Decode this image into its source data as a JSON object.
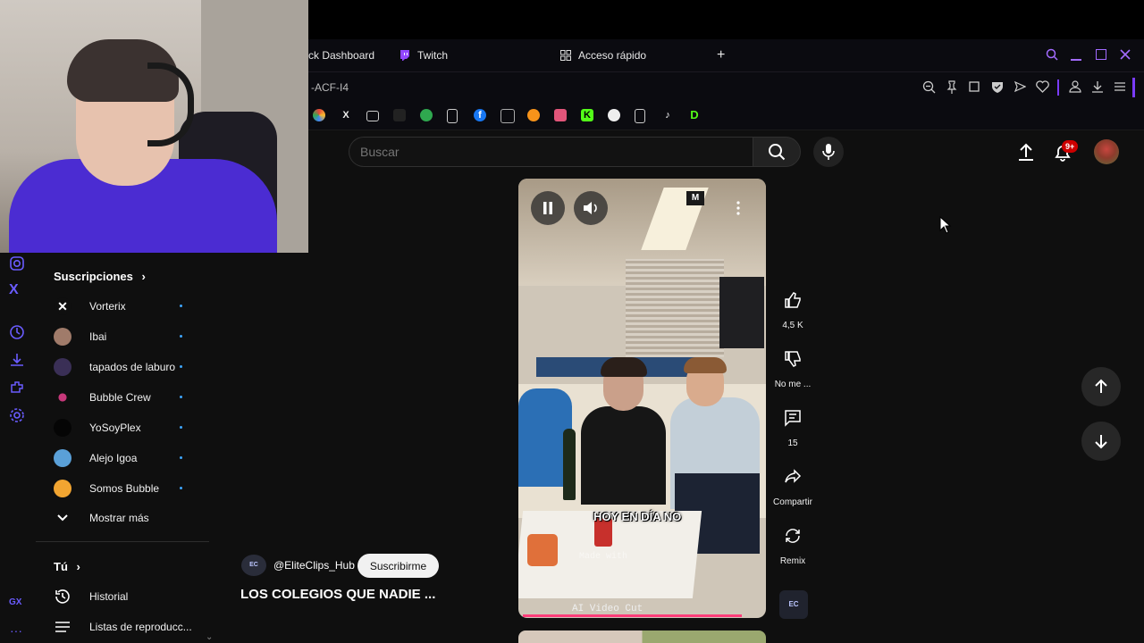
{
  "browser": {
    "tabs": [
      {
        "label": "ck Dashboard"
      },
      {
        "label": "Twitch"
      },
      {
        "label": "Acceso rápido"
      }
    ],
    "new_tab": "+",
    "address": "-ACF-I4"
  },
  "header": {
    "search_placeholder": "Buscar",
    "notification_badge": "9+"
  },
  "sidebar": {
    "subscriptions_title": "Suscripciones",
    "subscriptions": [
      {
        "name": "Vorterix"
      },
      {
        "name": "Ibai"
      },
      {
        "name": "tapados de laburo"
      },
      {
        "name": "Bubble Crew"
      },
      {
        "name": "YoSoyPlex"
      },
      {
        "name": "Alejo Igoa"
      },
      {
        "name": "Somos Bubble"
      }
    ],
    "show_more": "Mostrar más",
    "you_title": "Tú",
    "you_items": [
      {
        "label": "Historial"
      },
      {
        "label": "Listas de reproducc..."
      }
    ]
  },
  "short": {
    "channel": "@EliteClips_Hub",
    "subscribe_label": "Suscribirme",
    "title": "LOS COLEGIOS QUE NADIE ...",
    "caption": "HOY EN DÍA NO",
    "watermark": "AI Video Cut",
    "watermark2": "Made with"
  },
  "actions": {
    "likes": "4,5 K",
    "dislike": "No me ...",
    "comments": "15",
    "share": "Compartir",
    "remix": "Remix"
  }
}
